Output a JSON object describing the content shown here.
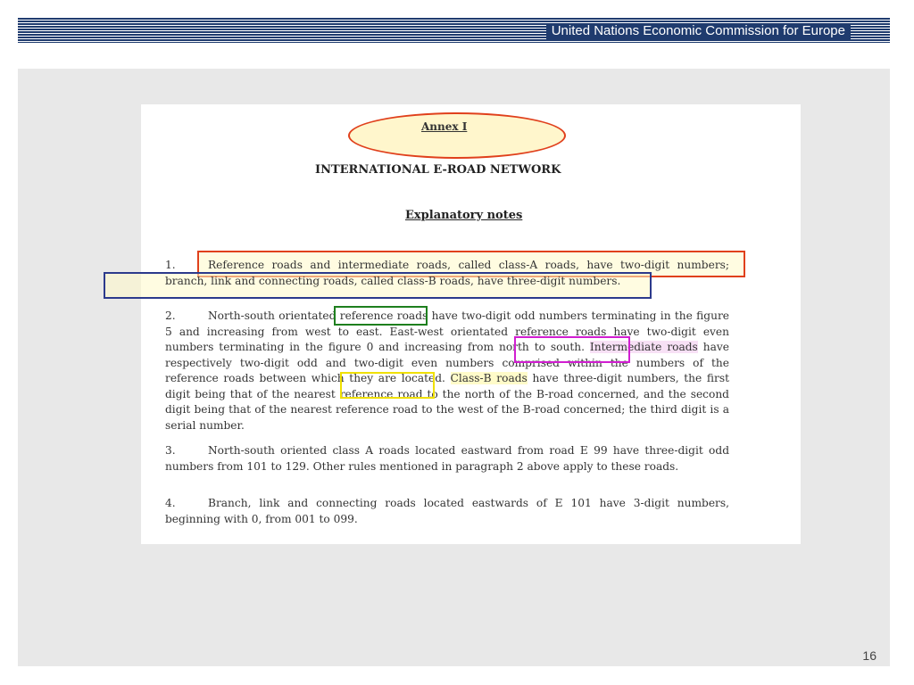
{
  "header": {
    "title": "United Nations Economic Commission for Europe"
  },
  "document": {
    "annex": "Annex I",
    "heading": "INTERNATIONAL E-ROAD NETWORK",
    "subheading": "Explanatory notes",
    "paragraphs": [
      {
        "number": "1.",
        "text_a": "Reference roads and intermediate roads, called class-A roads, have two-digit numbers; branch, link and connecting roads, called class-B roads, have three-digit numbers."
      },
      {
        "number": "2.",
        "text_a": "North-south orientated ",
        "highlight_1": "reference roads",
        "text_b": " have two-digit odd numbers terminating in the figure 5 and increasing from west to east. East-west orientated reference roads have two-digit even numbers terminating in the figure 0 and increasing from north to south. ",
        "highlight_2": "Intermediate roads",
        "text_c": " have respectively two-digit odd and two-digit even numbers comprised within the numbers of the reference roads between which they are located. ",
        "highlight_3": "Class-B roads",
        "text_d": " have three-digit numbers, the first digit being that of the nearest reference road to the north of the B-road concerned, and the second digit being that of the nearest reference road to the west of the B-road concerned; the third digit is a serial number."
      },
      {
        "number": "3.",
        "text_a": "North-south oriented class A roads located eastward from road E 99 have three-digit odd numbers from 101 to 129. Other rules mentioned in paragraph 2 above apply to these roads."
      },
      {
        "number": "4.",
        "text_a": "Branch, link and connecting roads located eastwards of E 101 have 3-digit numbers, beginning with 0, from 001 to 099."
      }
    ]
  },
  "page_number": "16"
}
